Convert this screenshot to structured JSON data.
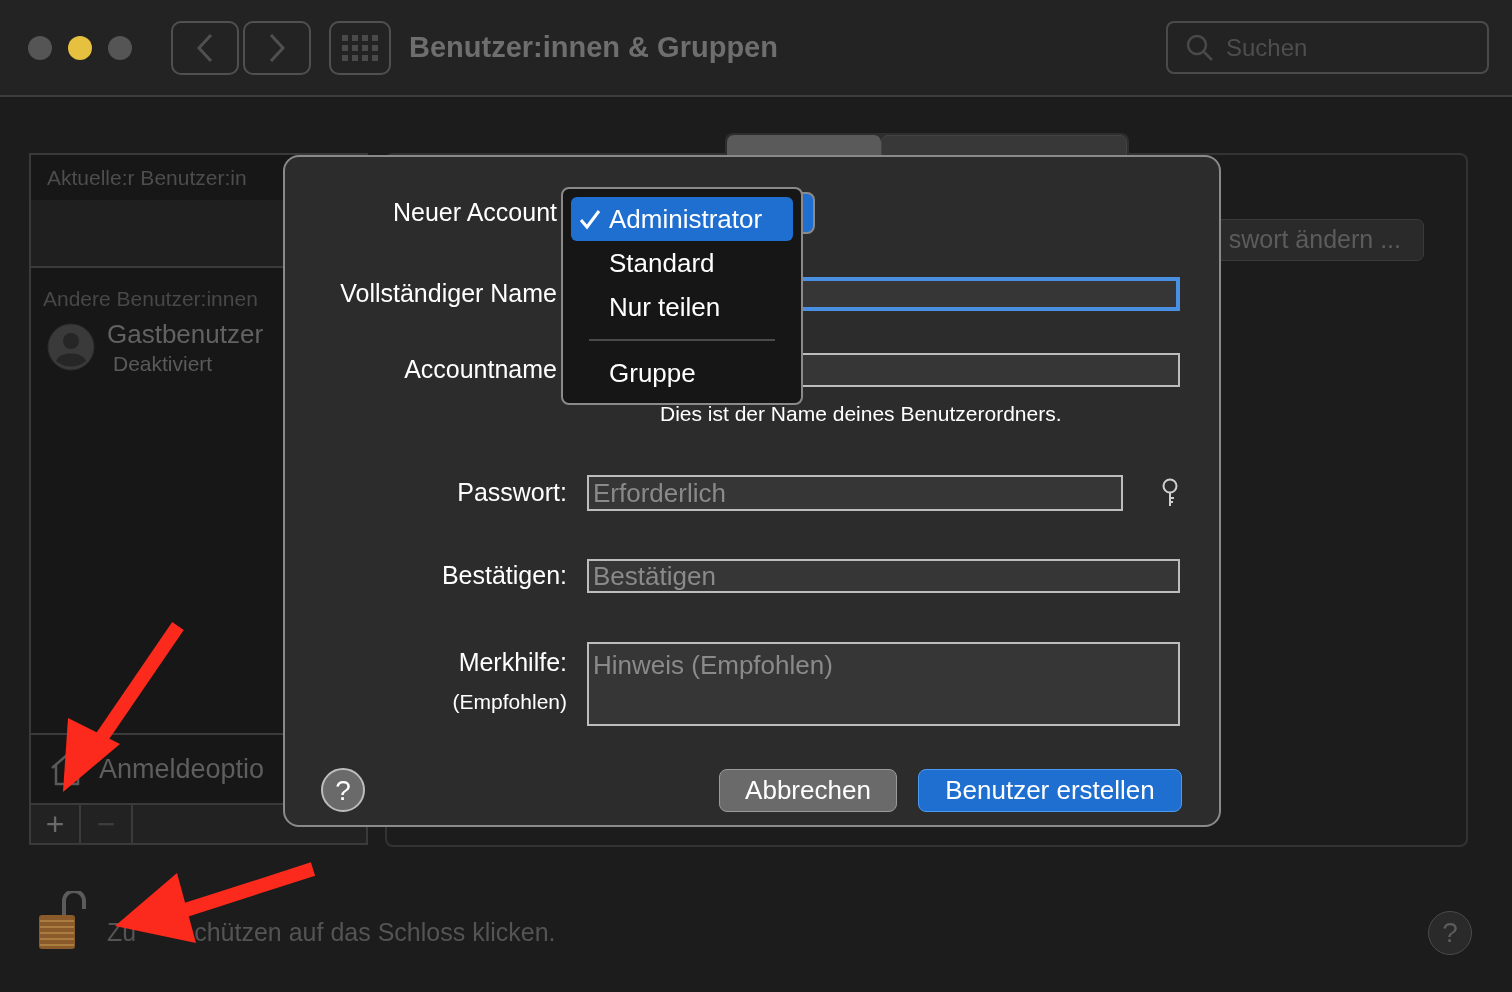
{
  "window": {
    "title": "Benutzer:innen & Gruppen",
    "search_placeholder": "Suchen"
  },
  "sidebar": {
    "current_header": "Aktuelle:r Benutzer:in",
    "other_header": "Andere Benutzer:innen",
    "users": [
      {
        "name": "Gastbenutzer",
        "status": "Deaktiviert"
      }
    ],
    "login_options": "Anmeldeoptio",
    "add": "+",
    "remove": "−"
  },
  "tabs": [
    {
      "selected": true
    },
    {
      "selected": false
    }
  ],
  "change_password_button": "swort ändern ...",
  "lock_hint": [
    "Zu",
    "chützen auf das Schloss klicken."
  ],
  "dialog": {
    "fields": [
      {
        "kind": "popup",
        "label": "Neuer Account"
      },
      {
        "kind": "text",
        "label": "Vollständiger Name",
        "focused": true
      },
      {
        "kind": "text",
        "label": "Accountname",
        "focused": false,
        "hint": "Dies ist der Name deines Benutzerordners."
      },
      {
        "kind": "password",
        "label": "Passwort:",
        "placeholder": "Erforderlich"
      },
      {
        "kind": "text",
        "label": "Bestätigen:",
        "placeholder": "Bestätigen",
        "focused": false
      },
      {
        "kind": "textarea",
        "label": "Merkhilfe:",
        "sublabel": "(Empfohlen)",
        "placeholder": "Hinweis (Empfohlen)"
      }
    ],
    "help": "?",
    "buttons": [
      {
        "kind": "secondary",
        "label": "Abbrechen"
      },
      {
        "kind": "primary",
        "label": "Benutzer erstellen"
      }
    ],
    "menu": [
      {
        "kind": "item",
        "label": "Administrator",
        "selected": true
      },
      {
        "kind": "item",
        "label": "Standard",
        "selected": false
      },
      {
        "kind": "item",
        "label": "Nur teilen",
        "selected": false
      },
      {
        "kind": "separator"
      },
      {
        "kind": "item",
        "label": "Gruppe",
        "selected": false
      }
    ]
  },
  "help": "?"
}
